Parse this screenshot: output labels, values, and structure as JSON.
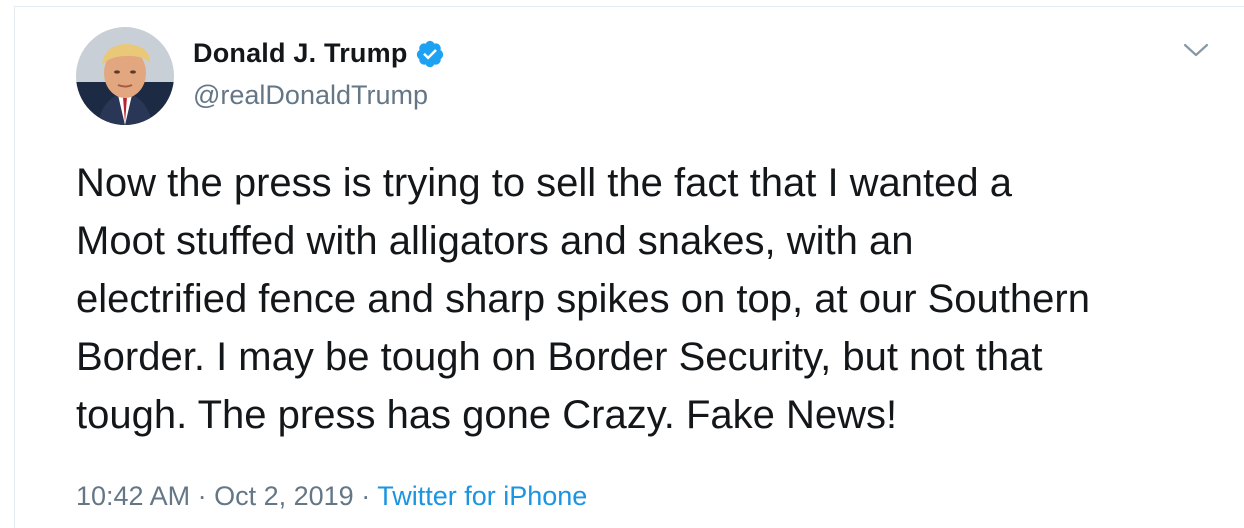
{
  "tweet": {
    "author": {
      "display_name": "Donald J. Trump",
      "handle": "@realDonaldTrump",
      "verified": true,
      "avatar_icon": "profile-photo"
    },
    "text_lines": [
      "Now the press is trying to sell the fact that I wanted a",
      "Moot stuffed with alligators and snakes, with an",
      "electrified fence and sharp spikes on top, at our Southern",
      "Border. I may be tough on Border Security, but not that",
      "tough. The press has gone Crazy. Fake News!"
    ],
    "time": "10:42 AM",
    "separator": "·",
    "date": "Oct 2, 2019",
    "source": "Twitter for iPhone",
    "menu_icon": "chevron-down-icon"
  },
  "colors": {
    "text": "#14171a",
    "secondary": "#657786",
    "link": "#1b95e0",
    "verified": "#1da1f2",
    "border": "#e6ecf0"
  }
}
